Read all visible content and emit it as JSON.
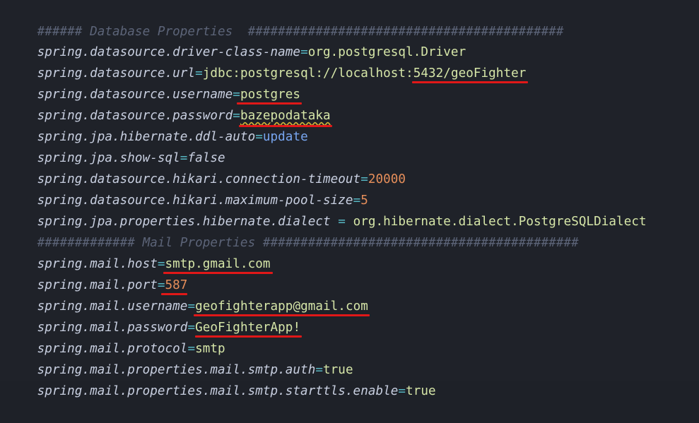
{
  "editor": {
    "lines": [
      {
        "type": "comment",
        "text": "###### Database Properties  ##########################################"
      },
      {
        "key": "spring.datasource.driver-class-name",
        "op": "=",
        "value": "org.postgresql.Driver"
      },
      {
        "key": "spring.datasource.url",
        "op": "=",
        "value_prefix": "jdbc:postgresql://localhost:",
        "value_marked": "5432/geoFighter"
      },
      {
        "key": "spring.datasource.username",
        "op": "=",
        "value_marked": "postgres"
      },
      {
        "key": "spring.datasource.password",
        "op": "=",
        "value_marked": "bazepodataka"
      },
      {
        "key": "spring.jpa.hibernate.ddl-auto",
        "op": "=",
        "value": "update"
      },
      {
        "key": "spring.jpa.show-sql",
        "op": "=",
        "value": "false"
      },
      {
        "key": "spring.datasource.hikari.connection-timeout",
        "op": "=",
        "value": "20000"
      },
      {
        "key": "spring.datasource.hikari.maximum-pool-size",
        "op": "=",
        "value": "5"
      },
      {
        "key": "spring.jpa.properties.hibernate.dialect",
        "op": " = ",
        "value": "org.hibernate.dialect.PostgreSQLDialect"
      },
      {
        "type": "comment",
        "text": "############# Mail Properties ##########################################"
      },
      {
        "key": "spring.mail.host",
        "op": "=",
        "value_marked": "smtp.gmail.com"
      },
      {
        "key": "spring.mail.port",
        "op": "=",
        "value_marked": "587"
      },
      {
        "key": "spring.mail.username",
        "op": "=",
        "value_marked": "geofighterapp@gmail.com"
      },
      {
        "key": "spring.mail.password",
        "op": "=",
        "value_marked": "GeoFighterApp!"
      },
      {
        "key": "spring.mail.protocol",
        "op": "=",
        "value": "smtp"
      },
      {
        "key": "spring.mail.properties.mail.smtp.auth",
        "op": "=",
        "value": "true"
      },
      {
        "key": "spring.mail.properties.mail.smtp.starttls.enable",
        "op": "=",
        "value": "true"
      }
    ]
  },
  "colors": {
    "background": "#1f2229",
    "comment": "#5c6478",
    "key": "#c8cfe0",
    "operator": "#56b6c2",
    "string_value": "#d6e6a8",
    "number_value": "#e58e5a",
    "keyword_value": "#78a6f0",
    "annotation_underline": "#e01818"
  }
}
